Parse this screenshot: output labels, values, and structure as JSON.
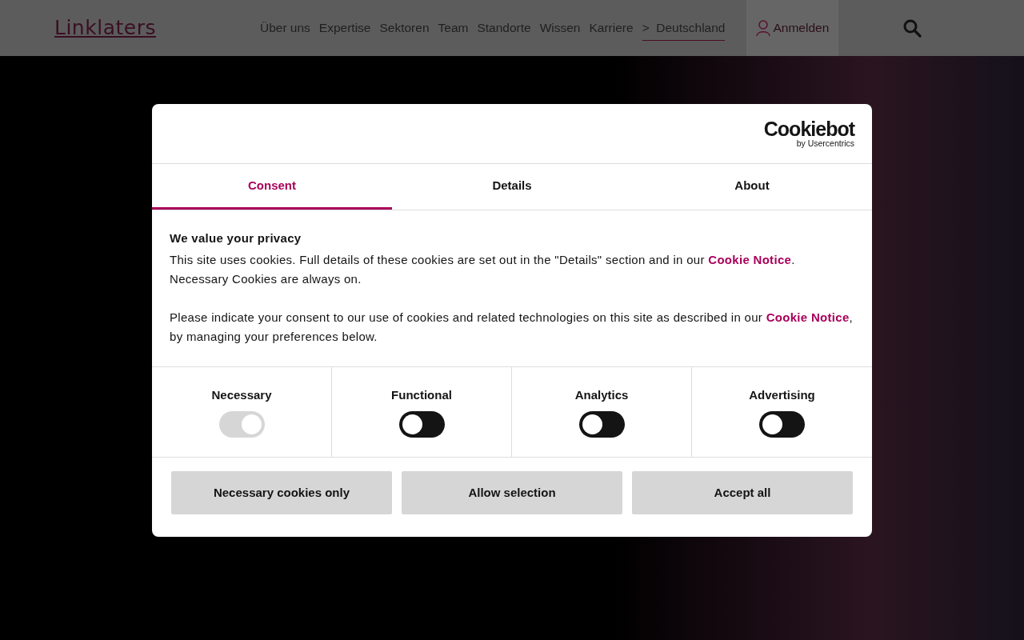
{
  "header": {
    "logo": "Linklaters",
    "nav": [
      {
        "label": "Über uns",
        "selected": false
      },
      {
        "label": "Expertise",
        "selected": false
      },
      {
        "label": "Sektoren",
        "selected": false
      },
      {
        "label": "Team",
        "selected": false
      },
      {
        "label": "Standorte",
        "selected": false
      },
      {
        "label": "Wissen",
        "selected": false
      },
      {
        "label": "Karriere",
        "selected": false
      }
    ],
    "region": {
      "prefix": ">",
      "label": "Deutschland",
      "selected": true
    },
    "login": "Anmelden"
  },
  "dialog": {
    "brand": {
      "name": "Cookiebot",
      "byline": "by Usercentrics"
    },
    "tabs": [
      {
        "label": "Consent",
        "selected": true
      },
      {
        "label": "Details",
        "selected": false
      },
      {
        "label": "About",
        "selected": false
      }
    ],
    "heading": "We value your privacy",
    "paragraphs": [
      [
        {
          "text": "This site uses cookies. Full details of these cookies are set out in the \"Details\" section and in our "
        },
        {
          "link": "Cookie Notice"
        },
        {
          "text": ". Necessary Cookies are always on."
        }
      ],
      [
        {
          "text": "Please indicate your consent to our use of cookies and related technologies on this site as described in our "
        },
        {
          "link": "Cookie Notice"
        },
        {
          "text": ", by managing your preferences below."
        }
      ]
    ],
    "toggles": [
      {
        "label": "Necessary",
        "on": true,
        "disabled": true
      },
      {
        "label": "Functional",
        "on": false,
        "disabled": false
      },
      {
        "label": "Analytics",
        "on": false,
        "disabled": false
      },
      {
        "label": "Advertising",
        "on": false,
        "disabled": false
      }
    ],
    "buttons": [
      "Necessary cookies only",
      "Allow selection",
      "Accept all"
    ]
  }
}
